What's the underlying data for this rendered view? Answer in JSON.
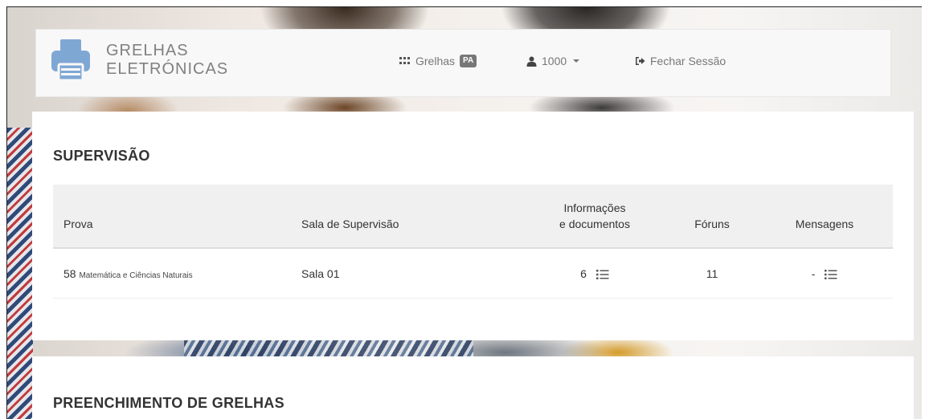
{
  "brand": {
    "line1": "GRELHAS",
    "line2": "ELETRÓNICAS"
  },
  "nav": {
    "grelhas_label": "Grelhas",
    "grelhas_badge": "PA",
    "user_label": "1000",
    "logout_label": "Fechar Sessão"
  },
  "supervision": {
    "title": "SUPERVISÃO",
    "columns": {
      "prova": "Prova",
      "sala": "Sala de Supervisão",
      "info_line1": "Informações",
      "info_line2": "e documentos",
      "foruns": "Fóruns",
      "mensagens": "Mensagens"
    },
    "rows": [
      {
        "prova_num": "58",
        "prova_name": "Matemática e Ciências Naturais",
        "sala": "Sala 01",
        "info_count": "6",
        "foruns": "11",
        "mensagens": "-"
      }
    ]
  },
  "fill": {
    "title": "PREENCHIMENTO DE GRELHAS"
  },
  "colors": {
    "navbar_bg": "#f8f8f8",
    "logo_blue": "#7fa7d4",
    "badge_bg": "#777777",
    "table_header_bg": "#f0f0f0"
  }
}
